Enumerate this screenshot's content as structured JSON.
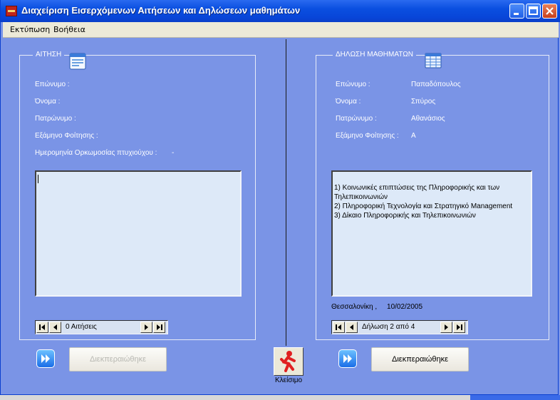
{
  "window": {
    "title": "Διαχείριση Εισερχόμενων Αιτήσεων και Δηλώσεων μαθημάτων"
  },
  "menu": {
    "items": [
      "Εκτύπωση",
      "Βοήθεια"
    ]
  },
  "left": {
    "group_label": "ΑΙΤΗΣΗ",
    "fields": [
      {
        "label": "Επώνυμο :",
        "value": ""
      },
      {
        "label": "Όνομα :",
        "value": ""
      },
      {
        "label": "Πατρώνυμο :",
        "value": ""
      },
      {
        "label": "Εξάμηνο Φοίτησης :",
        "value": ""
      },
      {
        "label": "Ημερομηνία Ορκωμοσίας πτυχιούχου :",
        "value": "-"
      }
    ],
    "textbox": "",
    "nav": {
      "text": "0 Αιτήσεις"
    },
    "complete_button": "Διεκπεραιώθηκε"
  },
  "right": {
    "group_label": "ΔΗΛΩΣΗ ΜΑΘΗΜΑΤΩΝ",
    "fields": [
      {
        "label": "Επώνυμο :",
        "value": "Παπαδόπουλος"
      },
      {
        "label": "Όνομα :",
        "value": "Σπύρος"
      },
      {
        "label": "Πατρώνυμο :",
        "value": "Αθανάσιος"
      },
      {
        "label": "Εξάμηνο Φοίτησης :",
        "value": "Α"
      }
    ],
    "courses": [
      "1) Κοινωνικές επιπτώσεις της Πληροφορικής και των Τηλεπικοινωνιών",
      "2) Πληροφορική Τεχνολογία και Στρατηγικό Management",
      "3) Δίκαιο Πληροφορικής και Τηλεπικοινωνιών"
    ],
    "place_date": "Θεσσαλονίκη ,     10/02/2005",
    "nav": {
      "text": "Δήλωση 2 από 4"
    },
    "complete_button": "Διεκπεραιώθηκε"
  },
  "close": {
    "label": "Κλείσιμο"
  }
}
